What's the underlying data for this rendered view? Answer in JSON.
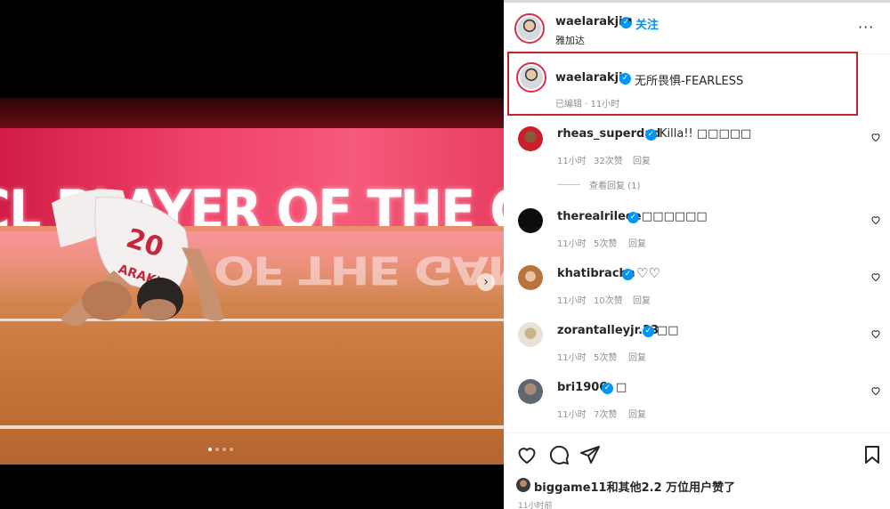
{
  "post": {
    "banner_text": "CL PLAYER OF THE GAME",
    "jersey_name": "ARAKJI",
    "jersey_number": "20",
    "carousel": {
      "count": 4,
      "active_index": 0
    }
  },
  "header": {
    "username": "waelarakji",
    "follow_label": "关注",
    "separator": "•",
    "location": "雅加达",
    "more_label": "···"
  },
  "caption": {
    "username": "waelarakji",
    "text": "无所畏惧-FEARLESS",
    "meta": "已编辑 · 11小时"
  },
  "comments": [
    {
      "username": "rheas_superdad",
      "text": "Killa!! □□□□□",
      "time": "11小时",
      "likes": "32次赞",
      "reply": "回复"
    },
    {
      "username": "therealrileee",
      "text": "□□□□□□",
      "time": "11小时",
      "likes": "5次赞",
      "reply": "回复"
    },
    {
      "username": "khatibracha",
      "text": "♡♡",
      "time": "11小时",
      "likes": "10次赞",
      "reply": "回复"
    },
    {
      "username": "zorantalleyjr.23",
      "text": "□□",
      "time": "11小时",
      "likes": "5次赞",
      "reply": "回复"
    },
    {
      "username": "bri1906",
      "text": "□",
      "time": "11小时",
      "likes": "7次赞",
      "reply": "回复"
    }
  ],
  "view_replies": "查看回复 (1)",
  "footer": {
    "likes_text": "biggame11和其他2.2 万位用户赞了",
    "post_time": "11小时前"
  },
  "colors": {
    "verified": "#0095f6",
    "follow": "#0095f6",
    "highlight_border": "#c0242e"
  }
}
